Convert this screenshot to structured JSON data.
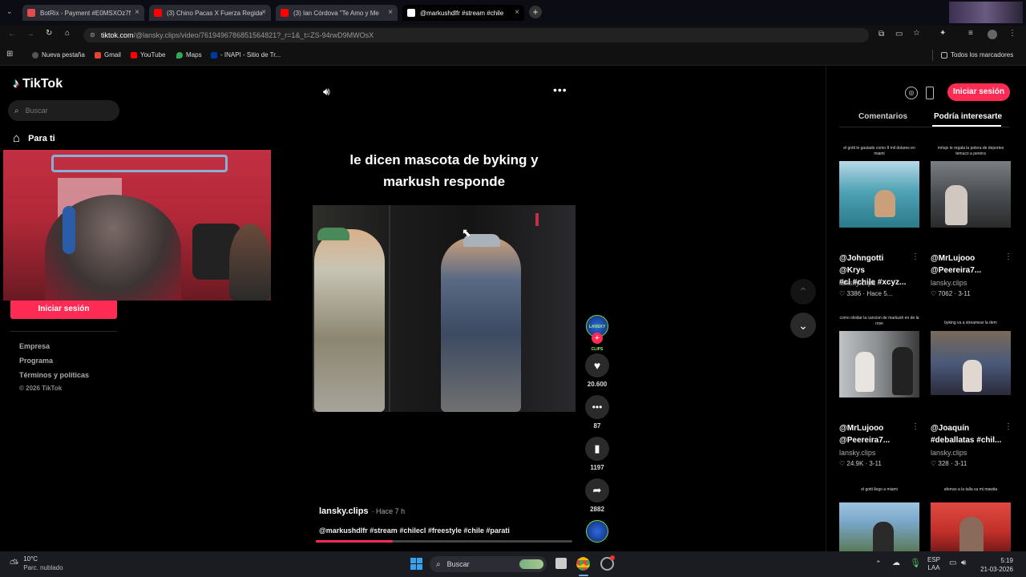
{
  "browser": {
    "tabs": [
      {
        "title": "BotRix - Payment #E0MSXOz7f",
        "favicon_color": "#e34c4c"
      },
      {
        "title": "(3) Chino Pacas X Fuerza Regida",
        "favicon_color": "#ff0000"
      },
      {
        "title": "(3) Ian Córdova \"Te Amo y Me",
        "favicon_color": "#ff0000"
      },
      {
        "title": "@markushdlfr #stream #chile",
        "favicon_color": "#ffffff"
      }
    ],
    "url_domain": "tiktok.com",
    "url_path": "/@lansky.clips/video/7619496786851564821?_r=1&_t=ZS-94rwD9MWOsX",
    "bookmarks": [
      "Nueva pestaña",
      "Gmail",
      "YouTube",
      "Maps",
      "- INAPI - Sitio de Tr...",
      "Todos los marcadores"
    ]
  },
  "sidebar": {
    "logo": "TikTok",
    "search_placeholder": "Buscar",
    "nav_for_you": "Para ti",
    "login_button": "Iniciar sesión",
    "footer": [
      "Empresa",
      "Programa",
      "Términos y políticas",
      "© 2026 TikTok"
    ]
  },
  "video": {
    "caption_line1": "le dicen mascota de byking y",
    "caption_line2": "markush responde",
    "author": "lansky.clips",
    "time_ago": "· Hace 7 h",
    "hashtags": "@markushdlfr #stream #chilecl #freestyle #chile #parati",
    "progress": 0.3,
    "avatar_label": "LANSKY CLIPS",
    "actions": {
      "likes": "20.600",
      "comments": "87",
      "saves": "1197",
      "shares": "2882"
    }
  },
  "right_panel": {
    "login_button": "Iniciar sesión",
    "tabs": [
      "Comentarios",
      "Podría interesarte"
    ],
    "active_tab": "Podría interesarte",
    "cards": [
      {
        "title": "el gotti le gastado como 8 mil dolares en miami",
        "tags_line1": "@Johngotti @Krys",
        "tags_line2": "#cl #chile #xcyz...",
        "user": "lansky.clips",
        "stats": "3386 · Hace 5...",
        "thumb_color": "#4fa3b5"
      },
      {
        "title": "mrlujo le regala la polera de deportes temuco a pereira",
        "tags_line1": "@MrLujooo",
        "tags_line2": "@Peereira7...",
        "user": "lansky.clips",
        "stats": "7062 · 3-11",
        "thumb_color": "#5a5e63"
      },
      {
        "title": "como olvidar la cancion de markush en de la rose",
        "tags_line1": "@MrLujooo",
        "tags_line2": "@Peereira7...",
        "user": "lansky.clips",
        "stats": "24.9K · 3-11",
        "thumb_color": "#8a8d90"
      },
      {
        "title": "byking va a streamear la dem",
        "tags_line1": "@Joaquín",
        "tags_line2": "#deballatas #chil...",
        "user": "lansky.clips",
        "stats": "328 · 3-11",
        "thumb_color": "#4b5a7a"
      },
      {
        "title": "el gotti llego a miami",
        "thumb_color": "#7aa7c9"
      },
      {
        "title": "aferrao a la talla xa mi mawita",
        "thumb_color": "#c0302a"
      }
    ]
  },
  "taskbar": {
    "weather_temp": "10°C",
    "weather_desc": "Parc. nublado",
    "search": "Buscar",
    "lang1": "ESP",
    "lang2": "LAA",
    "time": "5:19",
    "date": "21-03-2026"
  },
  "colors": {
    "tiktok_red": "#fe2c55",
    "accent_underline": "#ffffff"
  }
}
